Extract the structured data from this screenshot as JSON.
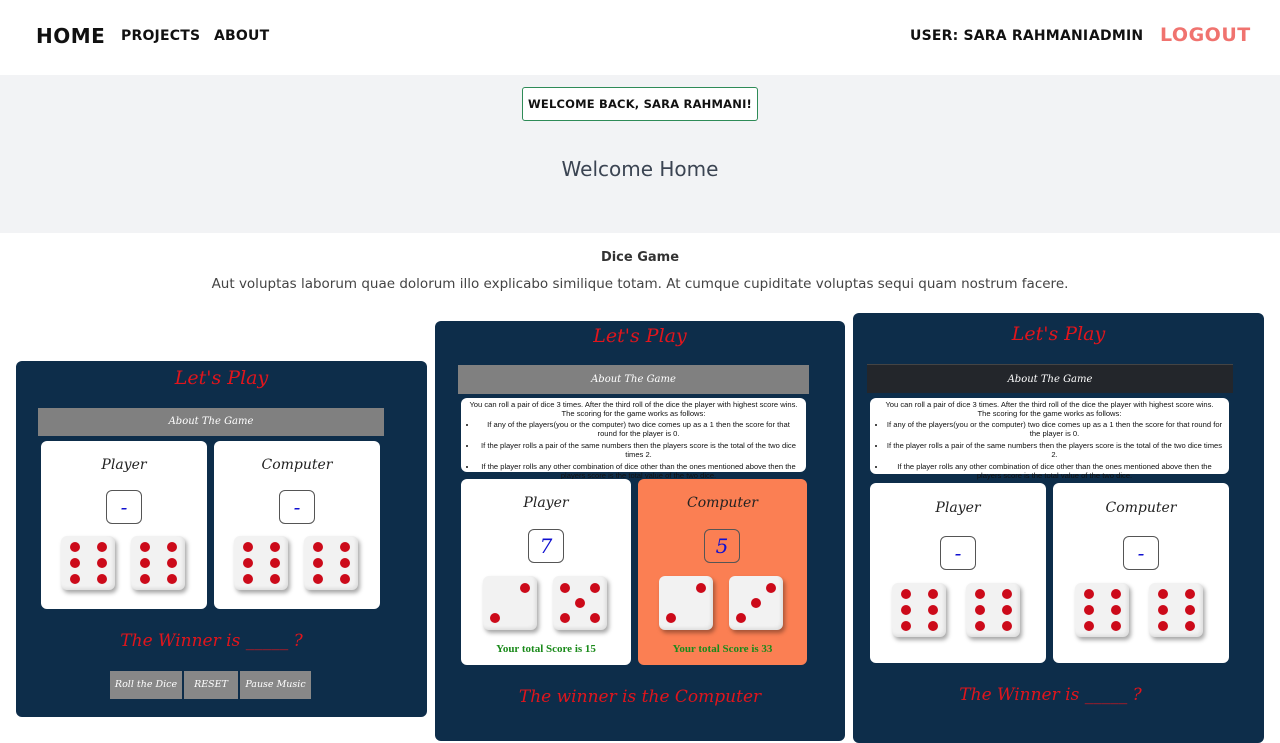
{
  "nav": {
    "home": "HOME",
    "projects": "PROJECTS",
    "about": "ABOUT",
    "user": "USER: SARA RAHMANI",
    "admin": "ADMIN",
    "logout": "LOGOUT"
  },
  "hero": {
    "badge": "WELCOME BACK, SARA RAHMANI!",
    "title": "Welcome Home"
  },
  "section": {
    "title": "Dice Game",
    "description": "Aut voluptas laborum quae dolorum illo explicabo similique totam. At cumque cupiditate voluptas sequi quam nostrum facere."
  },
  "game": {
    "lets_play": "Let's Play",
    "about_label": "About The Game",
    "rules_intro_1": "You can roll a pair of dice 3 times. After the third roll of the dice the player with highest score wins.",
    "rules_intro_2": "The scoring for the game works as follows:",
    "rules": [
      "If any of the players(you or the computer) two dice comes up as a 1 then the score for that round for the player is 0.",
      "If the player rolls a pair of the same numbers then the players score is the total of the two dice times 2.",
      "If the player rolls any other combination of dice other than the ones mentioned above then the players score is the total value of the two dice."
    ],
    "player_label": "Player",
    "computer_label": "Computer",
    "winner_unknown": "The Winner is _____ ?",
    "buttons": {
      "roll": "Roll the Dice",
      "reset": "RESET",
      "pause": "Pause Music"
    }
  },
  "card1": {
    "player_score": "-",
    "computer_score": "-",
    "player_dice": [
      6,
      6
    ],
    "computer_dice": [
      6,
      6
    ]
  },
  "card2": {
    "player_score": "7",
    "computer_score": "5",
    "player_dice": [
      2,
      5
    ],
    "computer_dice": [
      2,
      3
    ],
    "player_total": "Your total Score is 15",
    "computer_total": "Your total Score is 33",
    "winner": "The winner is the Computer"
  },
  "card3": {
    "player_score": "-",
    "computer_score": "-",
    "player_dice": [
      6,
      6
    ],
    "computer_dice": [
      6,
      6
    ]
  },
  "colors": {
    "card_bg": "#0d2d4a",
    "accent_red": "#e0151c",
    "logout": "#f0736f",
    "computer_highlight": "#fb7f53",
    "score_green": "#1a8a1a"
  }
}
